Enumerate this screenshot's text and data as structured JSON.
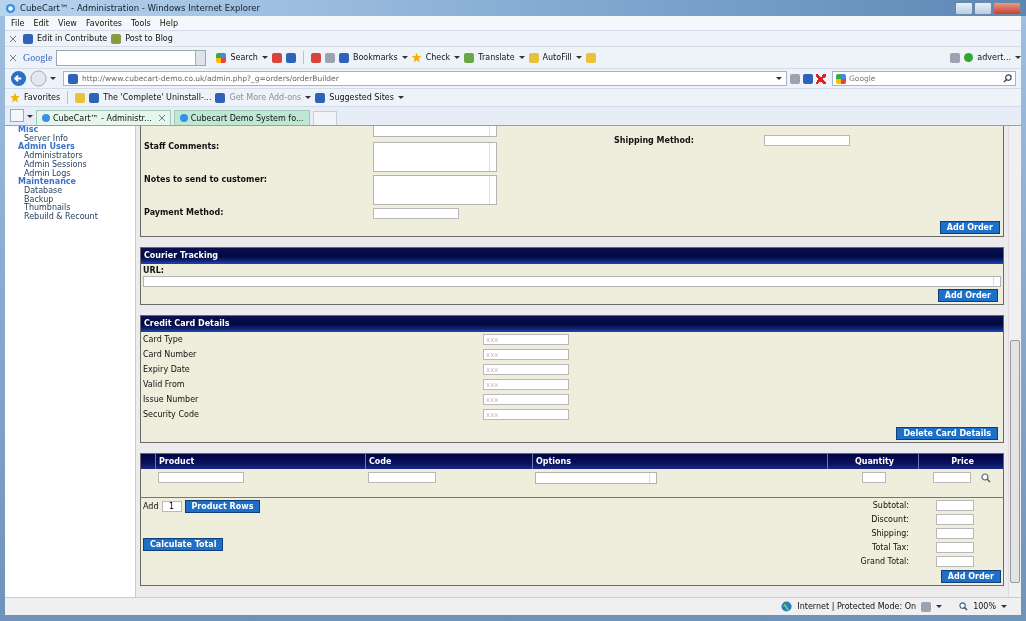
{
  "window": {
    "title": "CubeCart™ - Administration - Windows Internet Explorer"
  },
  "menu": [
    "File",
    "Edit",
    "View",
    "Favorites",
    "Tools",
    "Help"
  ],
  "contribute_bar": [
    "Edit in Contribute",
    "Post to Blog"
  ],
  "google_toolbar": {
    "logo": "Google",
    "items": [
      "Search",
      "Bookmarks",
      "Check",
      "Translate",
      "AutoFill"
    ],
    "account": "advert..."
  },
  "address_bar": {
    "url": "http://www.cubecart-demo.co.uk/admin.php?_g=orders/orderBuilder",
    "search_placeholder": "Google"
  },
  "favorites_bar": {
    "label": "Favorites",
    "links": [
      {
        "label": "The 'Complete' Uninstall-...",
        "disabled": false
      },
      {
        "label": "Get More Add-ons",
        "disabled": true
      },
      {
        "label": "Suggested Sites",
        "disabled": false
      }
    ]
  },
  "tabs": [
    {
      "label": "CubeCart™ - Administr...",
      "selected": true
    },
    {
      "label": "Cubecart Demo System fo...",
      "selected": false
    }
  ],
  "sidebar": [
    {
      "title": "Misc",
      "items": [
        "Server Info"
      ]
    },
    {
      "title": "Admin Users",
      "items": [
        "Administrators",
        "Admin Sessions",
        "Admin Logs"
      ]
    },
    {
      "title": "Maintenance",
      "items": [
        "Database",
        "Backup",
        "Thumbnails",
        "Rebuild & Recount"
      ]
    }
  ],
  "order_panel": {
    "left_fields": [
      {
        "label": "Staff Comments:",
        "kind": "textarea"
      },
      {
        "label": "Notes to send to customer:",
        "kind": "textarea"
      },
      {
        "label": "Payment Method:",
        "kind": "text"
      }
    ],
    "right_fields": [
      {
        "label": "Shipping Method:"
      }
    ],
    "button": "Add Order"
  },
  "courier_tracking": {
    "title": "Courier Tracking",
    "label": "URL:",
    "button": "Add Order"
  },
  "credit_card": {
    "title": "Credit Card Details",
    "fields": [
      {
        "label": "Card Type",
        "placeholder": "xxx"
      },
      {
        "label": "Card Number",
        "placeholder": "xxx"
      },
      {
        "label": "Expiry Date",
        "placeholder": "xxx"
      },
      {
        "label": "Valid From",
        "placeholder": "xxx"
      },
      {
        "label": "Issue Number",
        "placeholder": "xxx"
      },
      {
        "label": "Security Code",
        "placeholder": "xxx"
      }
    ],
    "button": "Delete Card Details"
  },
  "products": {
    "columns": [
      "Product",
      "Code",
      "Options",
      "Quantity",
      "Price"
    ],
    "add_label": "Add",
    "rows_value": "1",
    "rows_button": "Product Rows",
    "calculate_button": "Calculate Total",
    "totals": [
      "Subtotal:",
      "Discount:",
      "Shipping:",
      "Total Tax:",
      "Grand Total:"
    ],
    "button": "Add Order"
  },
  "status_bar": {
    "zone": "Internet | Protected Mode: On",
    "zoom": "100%"
  }
}
